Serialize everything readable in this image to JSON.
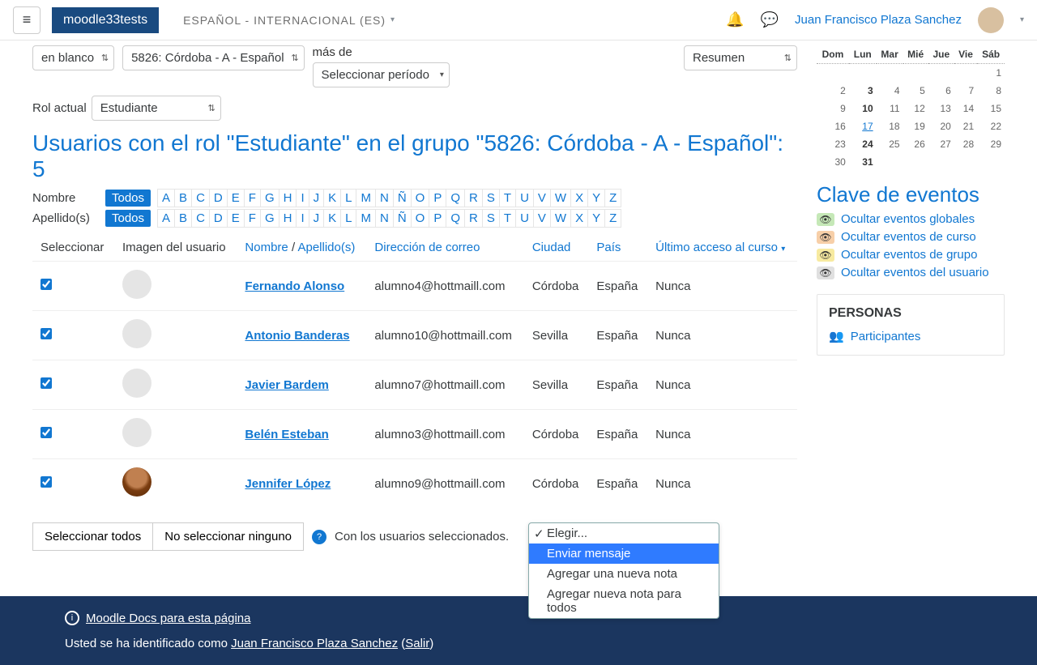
{
  "navbar": {
    "brand": "moodle33tests",
    "language": "ESPAÑOL - INTERNACIONAL (ES)",
    "user_name": "Juan Francisco Plaza Sanchez"
  },
  "filters": {
    "blank_option": "en blanco",
    "group_option": "5826: Córdoba - A - Español",
    "more_than": "más de",
    "period_option": "Seleccionar período",
    "summary_option": "Resumen",
    "current_role_label": "Rol actual",
    "current_role_value": "Estudiante"
  },
  "title": "Usuarios con el rol \"Estudiante\" en el grupo \"5826: Córdoba - A - Español\": 5",
  "filter_labels": {
    "firstname": "Nombre",
    "lastname": "Apellido(s)",
    "all": "Todos"
  },
  "alphabet": [
    "A",
    "B",
    "C",
    "D",
    "E",
    "F",
    "G",
    "H",
    "I",
    "J",
    "K",
    "L",
    "M",
    "N",
    "Ñ",
    "O",
    "P",
    "Q",
    "R",
    "S",
    "T",
    "U",
    "V",
    "W",
    "X",
    "Y",
    "Z"
  ],
  "table": {
    "headers": {
      "select": "Seleccionar",
      "picture": "Imagen del usuario",
      "name": "Nombre",
      "lastname": "Apellido(s)",
      "email": "Dirección de correo",
      "city": "Ciudad",
      "country": "País",
      "lastaccess": "Último acceso al curso"
    },
    "rows": [
      {
        "first": "Fernando",
        "last": "Alonso",
        "email": "alumno4@hottmaill.com",
        "city": "Córdoba",
        "country": "España",
        "access": "Nunca",
        "checked": true
      },
      {
        "first": "Antonio",
        "last": "Banderas",
        "email": "alumno10@hottmaill.com",
        "city": "Sevilla",
        "country": "España",
        "access": "Nunca",
        "checked": true
      },
      {
        "first": "Javier",
        "last": "Bardem",
        "email": "alumno7@hottmaill.com",
        "city": "Sevilla",
        "country": "España",
        "access": "Nunca",
        "checked": true
      },
      {
        "first": "Belén",
        "last": "Esteban",
        "email": "alumno3@hottmaill.com",
        "city": "Córdoba",
        "country": "España",
        "access": "Nunca",
        "checked": true
      },
      {
        "first": "Jennifer",
        "last": "López",
        "email": "alumno9@hottmaill.com",
        "city": "Córdoba",
        "country": "España",
        "access": "Nunca",
        "checked": true
      }
    ]
  },
  "actions": {
    "select_all": "Seleccionar todos",
    "select_none": "No seleccionar ninguno",
    "with_selected": "Con los usuarios seleccionados.",
    "dropdown": {
      "placeholder": "Elegir...",
      "opt_send": "Enviar mensaje",
      "opt_add_note": "Agregar una nueva nota",
      "opt_add_note_all": "Agregar nueva nota para todos"
    }
  },
  "calendar": {
    "days": [
      "Dom",
      "Lun",
      "Mar",
      "Mié",
      "Jue",
      "Vie",
      "Sáb"
    ],
    "weeks": [
      [
        "",
        "",
        "",
        "",
        "",
        "",
        1
      ],
      [
        2,
        3,
        4,
        5,
        6,
        7,
        8
      ],
      [
        9,
        10,
        11,
        12,
        13,
        14,
        15
      ],
      [
        16,
        17,
        18,
        19,
        20,
        21,
        22
      ],
      [
        23,
        24,
        25,
        26,
        27,
        28,
        29
      ],
      [
        30,
        31,
        "",
        "",
        "",
        "",
        ""
      ]
    ],
    "bold_col": 1,
    "today": 17
  },
  "legend": {
    "title": "Clave de eventos",
    "global": "Ocultar eventos globales",
    "course": "Ocultar eventos de curso",
    "group": "Ocultar eventos de grupo",
    "user": "Ocultar eventos del usuario"
  },
  "people_block": {
    "title": "PERSONAS",
    "link": "Participantes"
  },
  "footer": {
    "docs": "Moodle Docs para esta página",
    "logged_prefix": "Usted se ha identificado como ",
    "logged_user": "Juan Francisco Plaza Sanchez",
    "logout": "Salir"
  }
}
